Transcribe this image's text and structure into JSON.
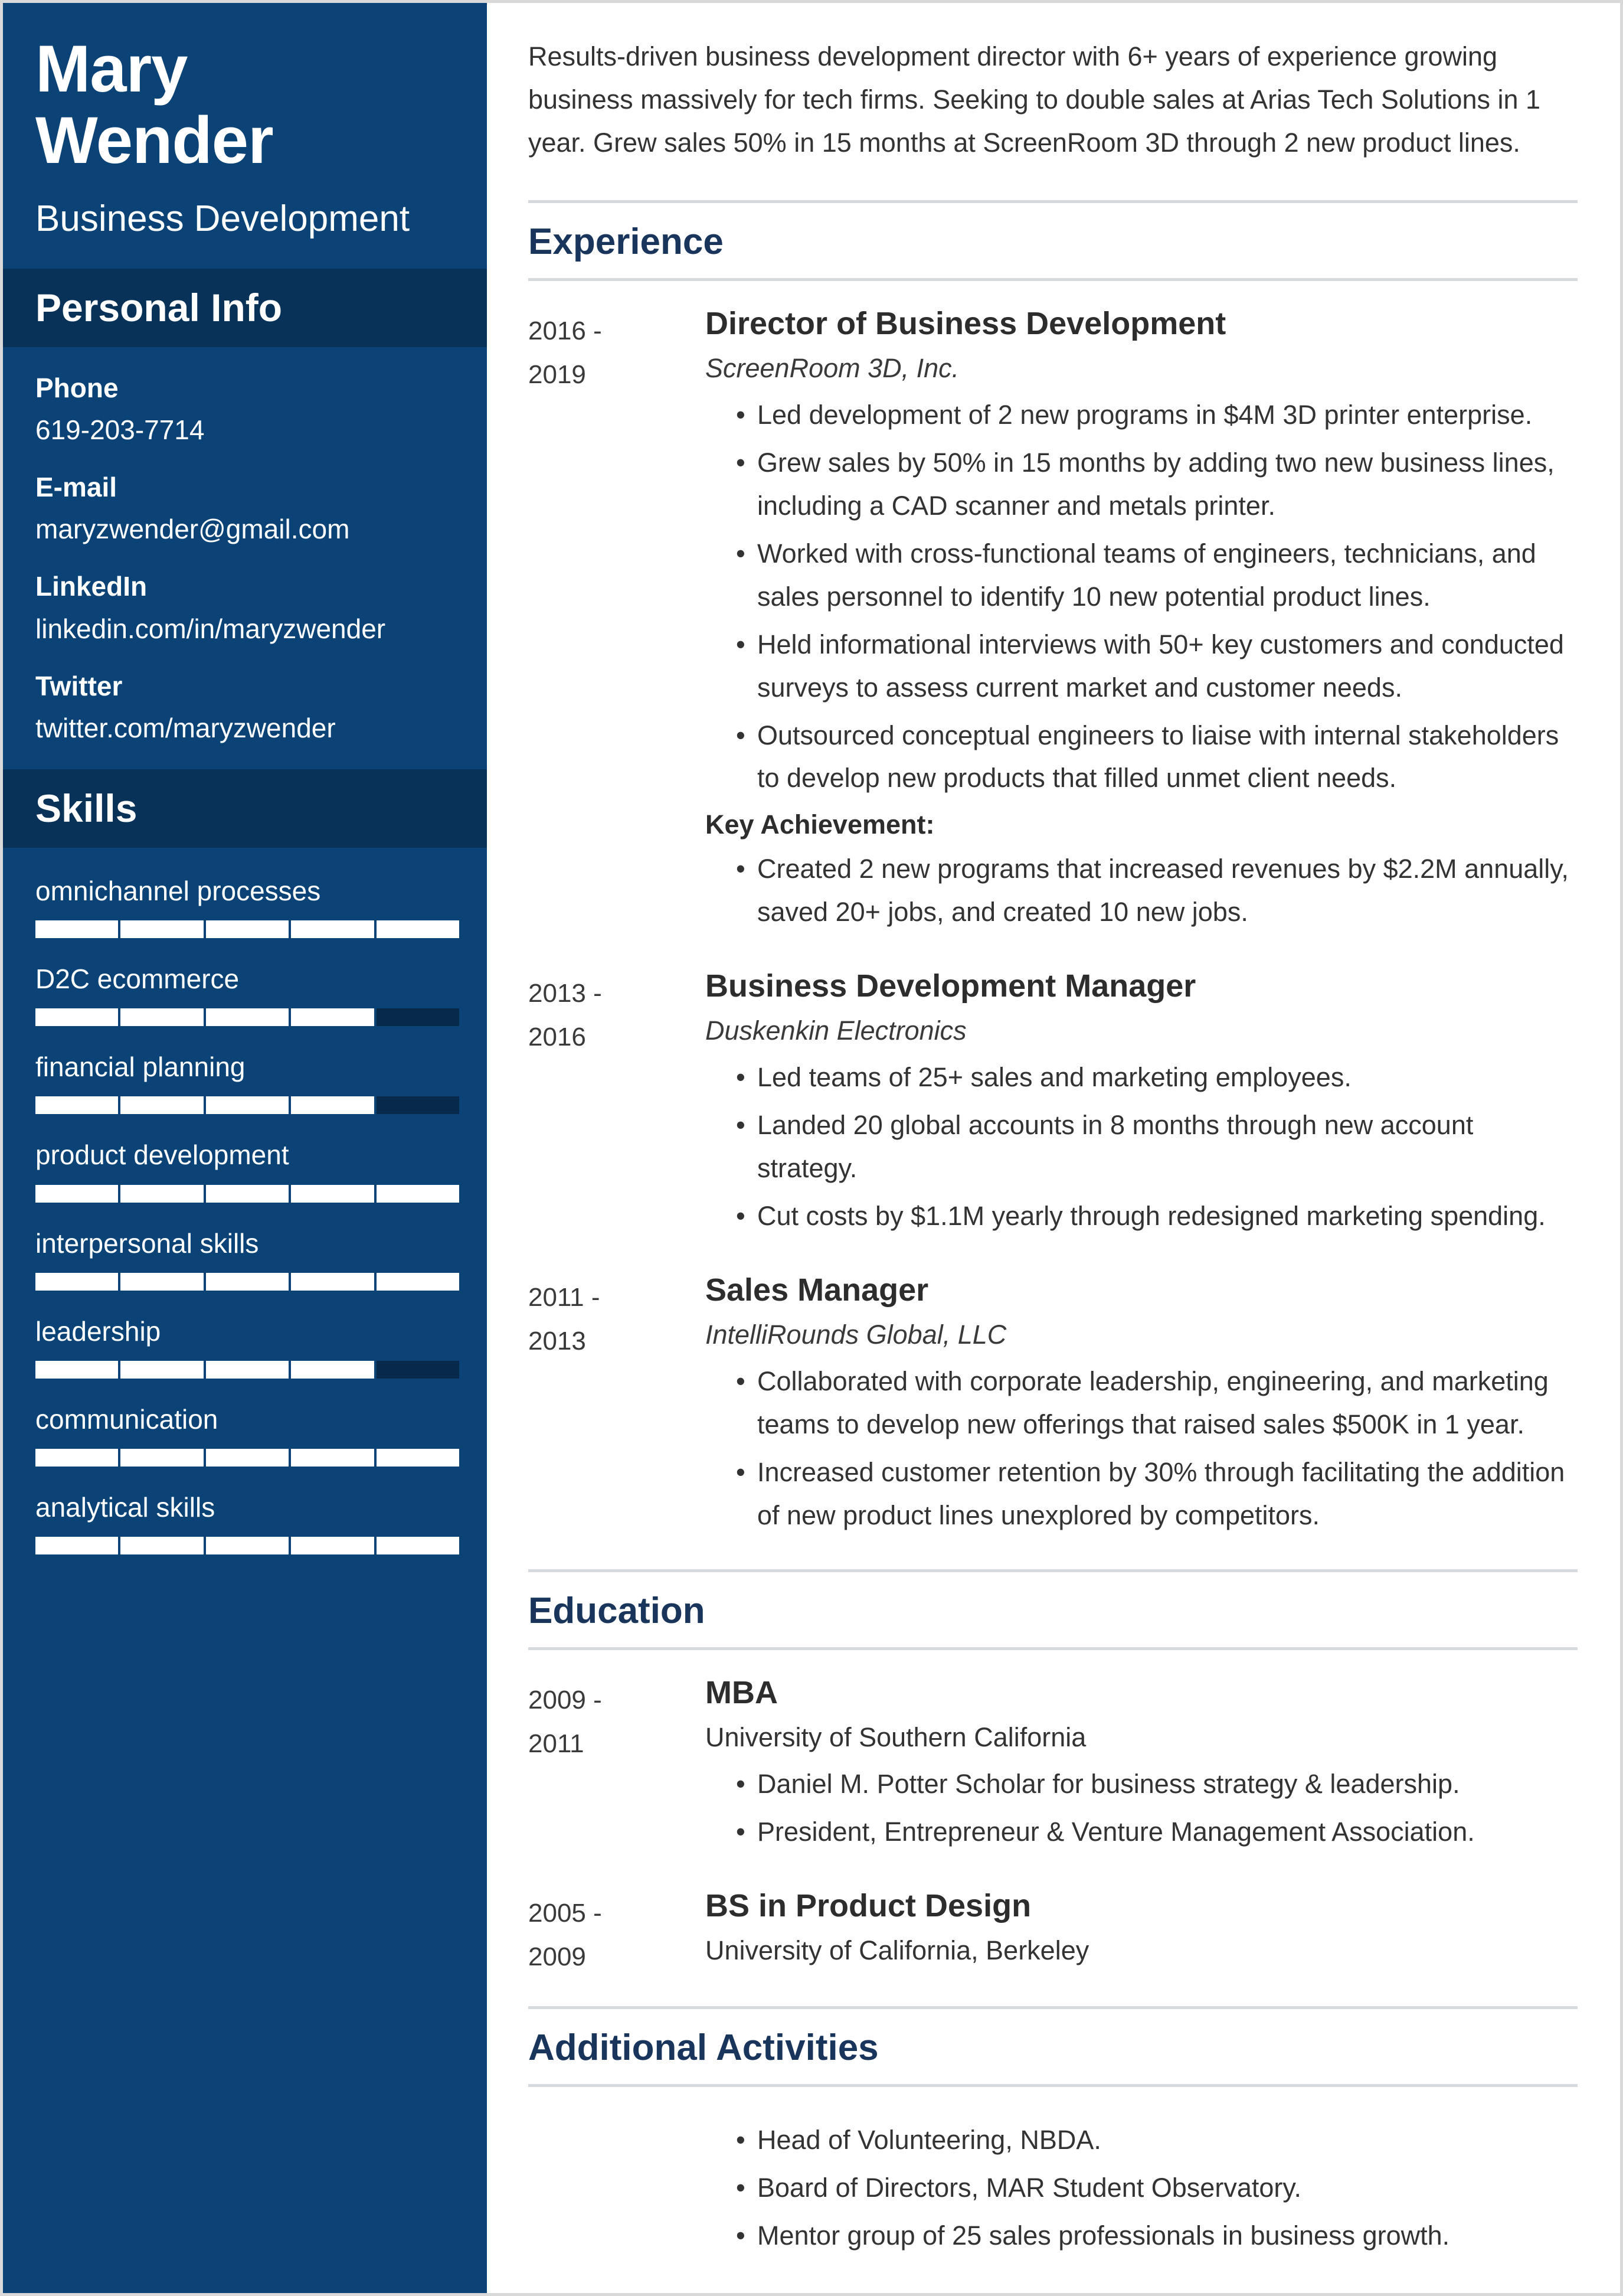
{
  "sidebar": {
    "first_name": "Mary",
    "last_name": "Wender",
    "job_title": "Business Development",
    "personal_info_heading": "Personal Info",
    "personal_info": [
      {
        "label": "Phone",
        "value": "619-203-7714"
      },
      {
        "label": "E-mail",
        "value": "maryzwender@gmail.com"
      },
      {
        "label": "LinkedIn",
        "value": "linkedin.com/in/maryzwender"
      },
      {
        "label": "Twitter",
        "value": "twitter.com/maryzwender"
      }
    ],
    "skills_heading": "Skills",
    "skills": [
      {
        "name": "omnichannel processes",
        "level": 5,
        "max": 5
      },
      {
        "name": "D2C ecommerce",
        "level": 4,
        "max": 5
      },
      {
        "name": "financial planning",
        "level": 4,
        "max": 5
      },
      {
        "name": "product development",
        "level": 5,
        "max": 5
      },
      {
        "name": "interpersonal skills",
        "level": 5,
        "max": 5
      },
      {
        "name": "leadership",
        "level": 4,
        "max": 5
      },
      {
        "name": "communication",
        "level": 5,
        "max": 5
      },
      {
        "name": "analytical skills",
        "level": 5,
        "max": 5
      }
    ]
  },
  "main": {
    "summary": "Results-driven business development director with 6+ years of experience growing business massively for tech firms. Seeking to double sales at Arias Tech Solutions in 1 year. Grew sales 50% in 15 months at ScreenRoom 3D through 2 new product lines.",
    "experience_heading": "Experience",
    "experience": [
      {
        "dates": "2016 -\n2019",
        "date_start": "2016 -",
        "date_end": "2019",
        "role": "Director of Business Development",
        "org": "ScreenRoom 3D, Inc.",
        "bullets": [
          "Led development of 2 new programs in $4M 3D printer enterprise.",
          "Grew sales by 50% in 15 months by adding two new business lines, including a CAD scanner and metals printer.",
          "Worked with cross-functional teams of engineers, technicians, and sales personnel to identify 10 new potential product lines.",
          "Held informational interviews with 50+ key customers and conducted surveys to assess current market and customer needs.",
          "Outsourced conceptual engineers to liaise with internal stakeholders to develop new products that filled unmet client needs."
        ],
        "kicker": "Key Achievement:",
        "kicker_bullets": [
          "Created 2 new programs that increased revenues by $2.2M annually, saved 20+ jobs, and created 10 new jobs."
        ]
      },
      {
        "date_start": "2013 -",
        "date_end": "2016",
        "role": "Business Development Manager",
        "org": "Duskenkin Electronics",
        "bullets": [
          "Led teams of 25+ sales and marketing employees.",
          "Landed 20 global accounts in 8 months through new account strategy.",
          "Cut costs by $1.1M yearly through redesigned marketing spending."
        ],
        "kicker": "",
        "kicker_bullets": []
      },
      {
        "date_start": "2011 -",
        "date_end": "2013",
        "role": "Sales Manager",
        "org": "IntelliRounds Global, LLC",
        "bullets": [
          "Collaborated with corporate leadership, engineering, and marketing teams to develop new offerings that raised sales $500K in 1 year.",
          "Increased customer retention by 30% through facilitating the addition of new product lines unexplored by competitors."
        ],
        "kicker": "",
        "kicker_bullets": []
      }
    ],
    "education_heading": "Education",
    "education": [
      {
        "date_start": "2009 -",
        "date_end": "2011",
        "degree": "MBA",
        "school": "University of Southern California",
        "bullets": [
          "Daniel M. Potter Scholar for business strategy & leadership.",
          "President, Entrepreneur & Venture Management Association."
        ]
      },
      {
        "date_start": "2005 -",
        "date_end": "2009",
        "degree": "BS in Product Design",
        "school": "University of California, Berkeley",
        "bullets": []
      }
    ],
    "activities_heading": "Additional Activities",
    "activities": [
      "Head of Volunteering, NBDA.",
      "Board of Directors, MAR Student Observatory.",
      "Mentor group of 25 sales professionals in business growth."
    ]
  },
  "colors": {
    "sidebar_bg": "#0c4377",
    "sidebar_band_bg": "#083258",
    "skill_off": "#07294a",
    "section_title": "#19355c",
    "body_text": "#333333",
    "rule": "#d6d9dd"
  }
}
